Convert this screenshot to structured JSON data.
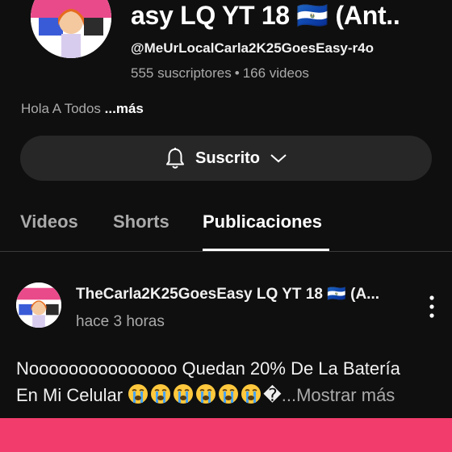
{
  "channel": {
    "title": "asy LQ YT 18 🇸🇻 (Ant..",
    "handle": "@MeUrLocalCarla2K25GoesEasy-r4o",
    "subscribers": "555 suscriptores",
    "separator": "•",
    "videos": "166 videos",
    "description": "Hola A Todos",
    "description_more": "...más",
    "subscribe_label": "Suscrito"
  },
  "tabs": [
    {
      "label": "Videos"
    },
    {
      "label": "Shorts"
    },
    {
      "label": "Publicaciones",
      "active": true
    }
  ],
  "post": {
    "author": "TheCarla2K25GoesEasy LQ YT 18 🇸🇻 (A...",
    "time": "hace 3 horas",
    "text_line1": "Nooooooooooooooo Quedan 20% De La Batería",
    "text_line2_prefix": "En Mi Celular",
    "emoji_count": 6,
    "trailing_glyph": "�",
    "more_label": "...Mostrar más"
  },
  "colors": {
    "background": "#0f0f0f",
    "button_bg": "#272727",
    "secondary_text": "#aaaaaa",
    "bottom_bar": "#f23c6c"
  }
}
